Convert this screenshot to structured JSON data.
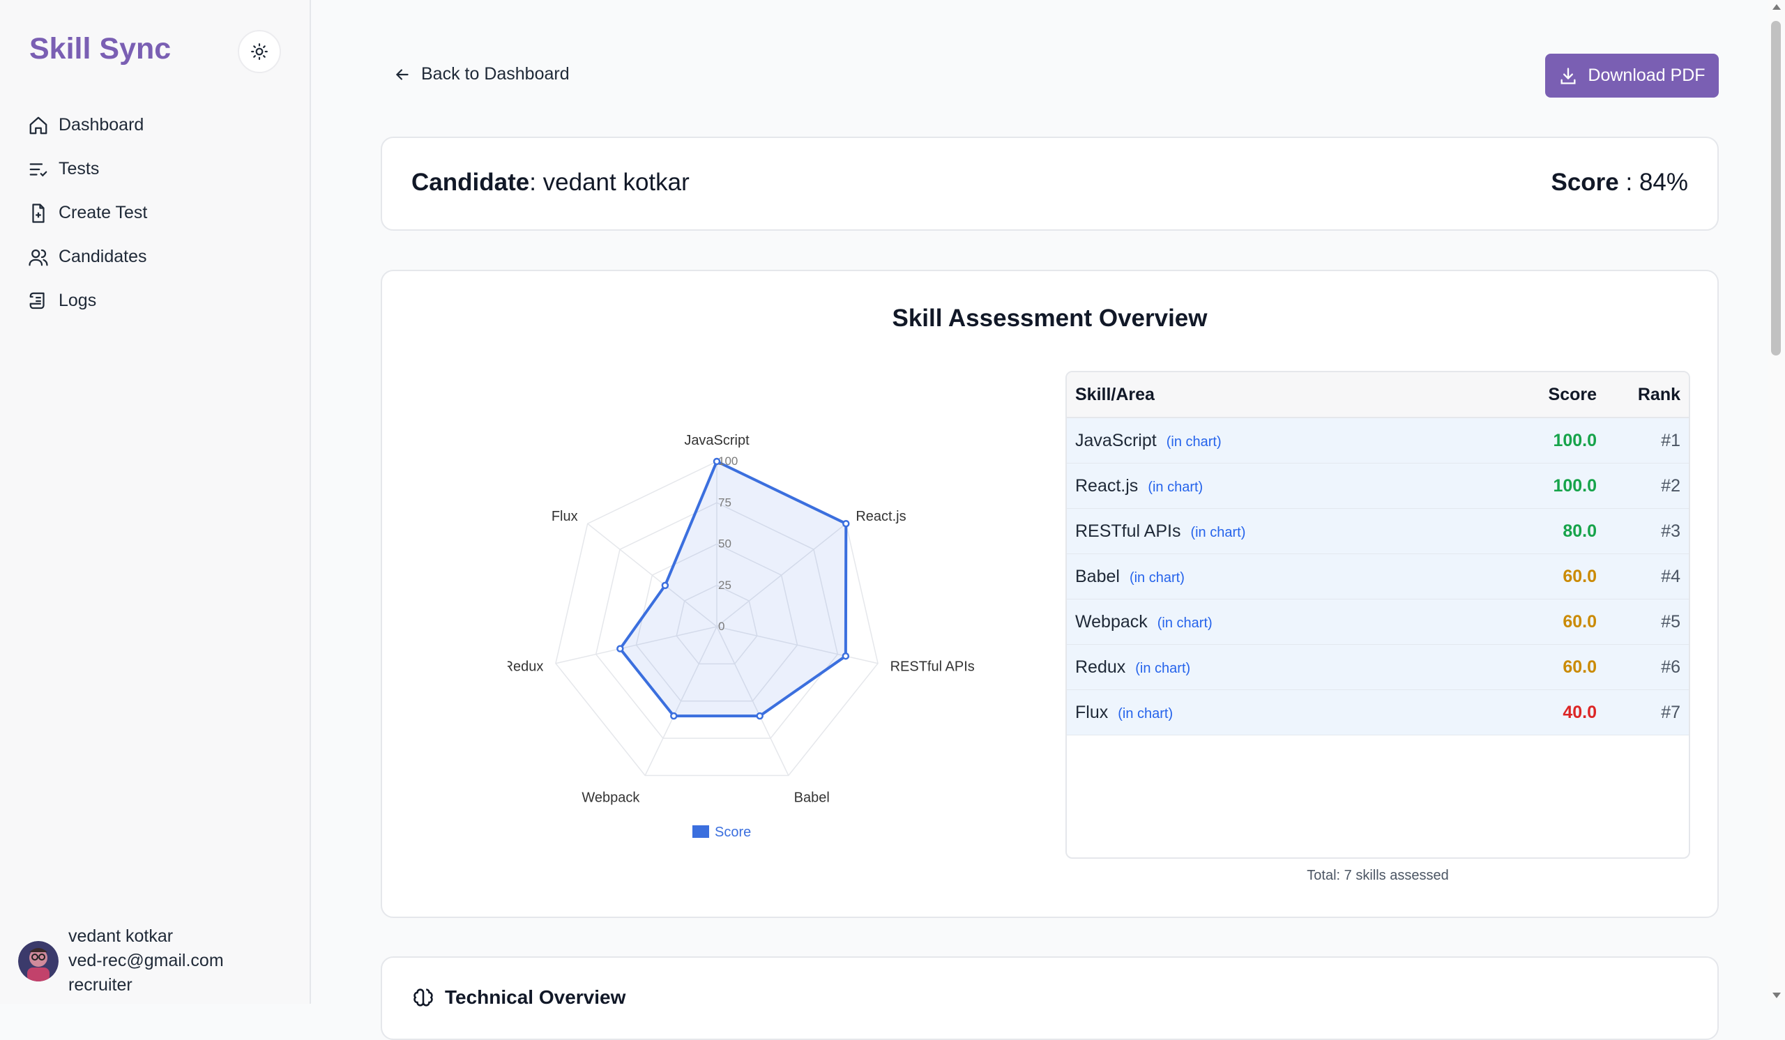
{
  "brand": "Skill Sync",
  "sidebar": {
    "items": [
      {
        "label": "Dashboard",
        "icon": "home-icon"
      },
      {
        "label": "Tests",
        "icon": "list-check-icon"
      },
      {
        "label": "Create Test",
        "icon": "file-plus-icon"
      },
      {
        "label": "Candidates",
        "icon": "users-icon"
      },
      {
        "label": "Logs",
        "icon": "scroll-icon"
      }
    ]
  },
  "user": {
    "name": "vedant kotkar",
    "email": "ved-rec@gmail.com",
    "role": "recruiter"
  },
  "header": {
    "back_label": "Back to Dashboard",
    "download_label": "Download PDF"
  },
  "candidate": {
    "label": "Candidate",
    "name": ": vedant kotkar",
    "score_label": "Score",
    "score_value": " : 84%"
  },
  "overview": {
    "title": "Skill Assessment Overview",
    "table": {
      "headers": [
        "Skill/Area",
        "Score",
        "Rank"
      ],
      "rows": [
        {
          "skill": "JavaScript",
          "chip": "(in chart)",
          "score": "100.0",
          "rank": "#1",
          "color": "#16a34a"
        },
        {
          "skill": "React.js",
          "chip": "(in chart)",
          "score": "100.0",
          "rank": "#2",
          "color": "#16a34a"
        },
        {
          "skill": "RESTful APIs",
          "chip": "(in chart)",
          "score": "80.0",
          "rank": "#3",
          "color": "#16a34a"
        },
        {
          "skill": "Babel",
          "chip": "(in chart)",
          "score": "60.0",
          "rank": "#4",
          "color": "#ca8a04"
        },
        {
          "skill": "Webpack",
          "chip": "(in chart)",
          "score": "60.0",
          "rank": "#5",
          "color": "#ca8a04"
        },
        {
          "skill": "Redux",
          "chip": "(in chart)",
          "score": "60.0",
          "rank": "#6",
          "color": "#ca8a04"
        },
        {
          "skill": "Flux",
          "chip": "(in chart)",
          "score": "40.0",
          "rank": "#7",
          "color": "#dc2626"
        }
      ],
      "total": "Total: 7 skills assessed"
    }
  },
  "chart_data": {
    "type": "radar",
    "categories": [
      "JavaScript",
      "React.js",
      "RESTful APIs",
      "Babel",
      "Webpack",
      "Redux",
      "Flux"
    ],
    "series": [
      {
        "name": "Score",
        "values": [
          100,
          100,
          80,
          60,
          60,
          60,
          40
        ],
        "color": "#3b6fde"
      }
    ],
    "ticks": [
      "0",
      "25",
      "50",
      "75",
      "100"
    ],
    "rlim": [
      0,
      100
    ],
    "legend": "bottom"
  },
  "tech_overview": {
    "title": "Technical Overview"
  },
  "colors": {
    "brand": "#7a5fb3",
    "accent": "#2563eb"
  }
}
